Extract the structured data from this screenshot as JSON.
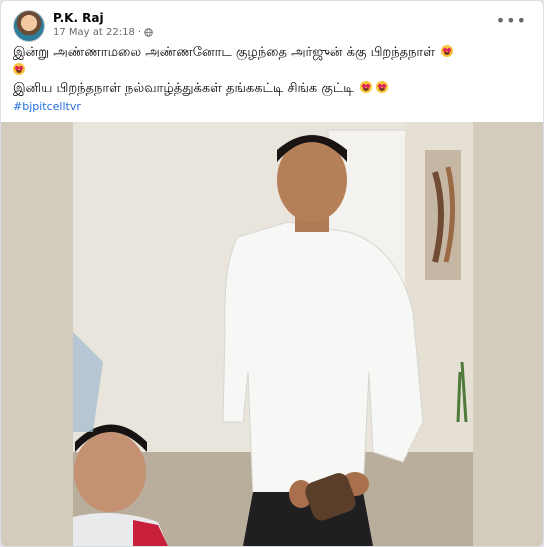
{
  "post": {
    "author": "P.K. Raj",
    "timestamp": "17 May at 22:18",
    "separator": "·",
    "privacy_icon": "globe-icon",
    "more_icon": "more-options-icon",
    "line1": "இன்று அண்ணாமலை அண்ணனோட குழந்தை அர்ஜுன் க்கு பிறந்தநாள்",
    "line2": "இனிய பிறந்தநாள் நல்வாழ்த்துக்கள் தங்ககட்டி சிங்க குட்டி",
    "hashtag": "#bjpitcelltvr",
    "emoji_name": "heart-eyes-emoji-icon"
  },
  "colors": {
    "link": "#216fdb",
    "meta_text": "#65676b",
    "text": "#050505"
  }
}
